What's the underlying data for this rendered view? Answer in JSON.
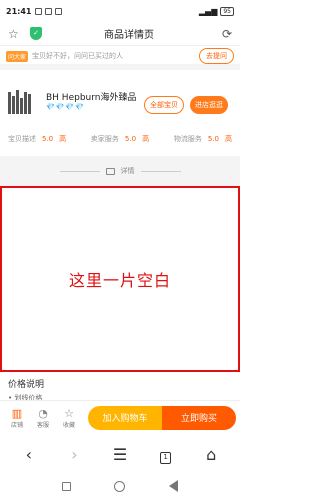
{
  "status_bar": {
    "time": "21:41",
    "battery": "95"
  },
  "address_bar": {
    "title": "商品详情页"
  },
  "qa": {
    "badge": "问大家",
    "text": "宝贝好不好，问问已买过的人",
    "button": "去提问"
  },
  "shop": {
    "name": "BH Hepburn海外臻品",
    "rating": "💎💎💎💎",
    "btn_all": "全部宝贝",
    "btn_store": "进店逛逛",
    "scores": [
      {
        "label": "宝贝描述",
        "value": "5.0",
        "level": "高"
      },
      {
        "label": "卖家服务",
        "value": "5.0",
        "level": "高"
      },
      {
        "label": "物流服务",
        "value": "5.0",
        "level": "高"
      }
    ]
  },
  "detail_header": {
    "label": "详情"
  },
  "blank_notice": "这里一片空白",
  "price": {
    "title": "价格说明",
    "item": "• 划线价格"
  },
  "action_bar": {
    "store": "店铺",
    "service": "客服",
    "favorite": "收藏",
    "add_cart": "加入购物车",
    "buy_now": "立即购买"
  },
  "browser_nav": {
    "tab_count": "1"
  },
  "colors": {
    "accent": "#ff5a00",
    "cart": "#ffb400",
    "highlight": "#e01010"
  },
  "icons": [
    "star-icon",
    "shield-icon",
    "reload-icon",
    "store-icon",
    "service-icon",
    "favorite-icon",
    "back-icon",
    "forward-icon",
    "menu-icon",
    "tabs-icon",
    "home-icon"
  ]
}
